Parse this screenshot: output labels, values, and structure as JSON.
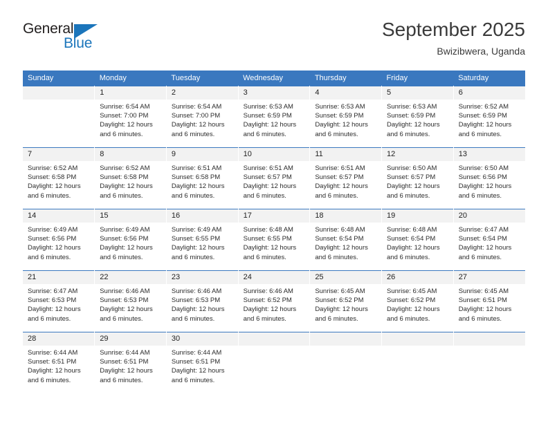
{
  "brand": {
    "name_dark": "General",
    "name_blue": "Blue",
    "accent_color": "#1b75bb"
  },
  "header": {
    "title": "September 2025",
    "subtitle": "Bwizibwera, Uganda"
  },
  "theme": {
    "header_row_color": "#3a78bf",
    "daynum_band_color": "#f2f2f2",
    "text_color": "#2b2b2b"
  },
  "weekday_headers": [
    "Sunday",
    "Monday",
    "Tuesday",
    "Wednesday",
    "Thursday",
    "Friday",
    "Saturday"
  ],
  "weeks": [
    [
      {
        "day": "",
        "empty": true,
        "sunrise": "",
        "sunset": "",
        "daylight_line1": "",
        "daylight_line2": ""
      },
      {
        "day": "1",
        "empty": false,
        "sunrise": "Sunrise: 6:54 AM",
        "sunset": "Sunset: 7:00 PM",
        "daylight_line1": "Daylight: 12 hours",
        "daylight_line2": "and 6 minutes."
      },
      {
        "day": "2",
        "empty": false,
        "sunrise": "Sunrise: 6:54 AM",
        "sunset": "Sunset: 7:00 PM",
        "daylight_line1": "Daylight: 12 hours",
        "daylight_line2": "and 6 minutes."
      },
      {
        "day": "3",
        "empty": false,
        "sunrise": "Sunrise: 6:53 AM",
        "sunset": "Sunset: 6:59 PM",
        "daylight_line1": "Daylight: 12 hours",
        "daylight_line2": "and 6 minutes."
      },
      {
        "day": "4",
        "empty": false,
        "sunrise": "Sunrise: 6:53 AM",
        "sunset": "Sunset: 6:59 PM",
        "daylight_line1": "Daylight: 12 hours",
        "daylight_line2": "and 6 minutes."
      },
      {
        "day": "5",
        "empty": false,
        "sunrise": "Sunrise: 6:53 AM",
        "sunset": "Sunset: 6:59 PM",
        "daylight_line1": "Daylight: 12 hours",
        "daylight_line2": "and 6 minutes."
      },
      {
        "day": "6",
        "empty": false,
        "sunrise": "Sunrise: 6:52 AM",
        "sunset": "Sunset: 6:59 PM",
        "daylight_line1": "Daylight: 12 hours",
        "daylight_line2": "and 6 minutes."
      }
    ],
    [
      {
        "day": "7",
        "empty": false,
        "sunrise": "Sunrise: 6:52 AM",
        "sunset": "Sunset: 6:58 PM",
        "daylight_line1": "Daylight: 12 hours",
        "daylight_line2": "and 6 minutes."
      },
      {
        "day": "8",
        "empty": false,
        "sunrise": "Sunrise: 6:52 AM",
        "sunset": "Sunset: 6:58 PM",
        "daylight_line1": "Daylight: 12 hours",
        "daylight_line2": "and 6 minutes."
      },
      {
        "day": "9",
        "empty": false,
        "sunrise": "Sunrise: 6:51 AM",
        "sunset": "Sunset: 6:58 PM",
        "daylight_line1": "Daylight: 12 hours",
        "daylight_line2": "and 6 minutes."
      },
      {
        "day": "10",
        "empty": false,
        "sunrise": "Sunrise: 6:51 AM",
        "sunset": "Sunset: 6:57 PM",
        "daylight_line1": "Daylight: 12 hours",
        "daylight_line2": "and 6 minutes."
      },
      {
        "day": "11",
        "empty": false,
        "sunrise": "Sunrise: 6:51 AM",
        "sunset": "Sunset: 6:57 PM",
        "daylight_line1": "Daylight: 12 hours",
        "daylight_line2": "and 6 minutes."
      },
      {
        "day": "12",
        "empty": false,
        "sunrise": "Sunrise: 6:50 AM",
        "sunset": "Sunset: 6:57 PM",
        "daylight_line1": "Daylight: 12 hours",
        "daylight_line2": "and 6 minutes."
      },
      {
        "day": "13",
        "empty": false,
        "sunrise": "Sunrise: 6:50 AM",
        "sunset": "Sunset: 6:56 PM",
        "daylight_line1": "Daylight: 12 hours",
        "daylight_line2": "and 6 minutes."
      }
    ],
    [
      {
        "day": "14",
        "empty": false,
        "sunrise": "Sunrise: 6:49 AM",
        "sunset": "Sunset: 6:56 PM",
        "daylight_line1": "Daylight: 12 hours",
        "daylight_line2": "and 6 minutes."
      },
      {
        "day": "15",
        "empty": false,
        "sunrise": "Sunrise: 6:49 AM",
        "sunset": "Sunset: 6:56 PM",
        "daylight_line1": "Daylight: 12 hours",
        "daylight_line2": "and 6 minutes."
      },
      {
        "day": "16",
        "empty": false,
        "sunrise": "Sunrise: 6:49 AM",
        "sunset": "Sunset: 6:55 PM",
        "daylight_line1": "Daylight: 12 hours",
        "daylight_line2": "and 6 minutes."
      },
      {
        "day": "17",
        "empty": false,
        "sunrise": "Sunrise: 6:48 AM",
        "sunset": "Sunset: 6:55 PM",
        "daylight_line1": "Daylight: 12 hours",
        "daylight_line2": "and 6 minutes."
      },
      {
        "day": "18",
        "empty": false,
        "sunrise": "Sunrise: 6:48 AM",
        "sunset": "Sunset: 6:54 PM",
        "daylight_line1": "Daylight: 12 hours",
        "daylight_line2": "and 6 minutes."
      },
      {
        "day": "19",
        "empty": false,
        "sunrise": "Sunrise: 6:48 AM",
        "sunset": "Sunset: 6:54 PM",
        "daylight_line1": "Daylight: 12 hours",
        "daylight_line2": "and 6 minutes."
      },
      {
        "day": "20",
        "empty": false,
        "sunrise": "Sunrise: 6:47 AM",
        "sunset": "Sunset: 6:54 PM",
        "daylight_line1": "Daylight: 12 hours",
        "daylight_line2": "and 6 minutes."
      }
    ],
    [
      {
        "day": "21",
        "empty": false,
        "sunrise": "Sunrise: 6:47 AM",
        "sunset": "Sunset: 6:53 PM",
        "daylight_line1": "Daylight: 12 hours",
        "daylight_line2": "and 6 minutes."
      },
      {
        "day": "22",
        "empty": false,
        "sunrise": "Sunrise: 6:46 AM",
        "sunset": "Sunset: 6:53 PM",
        "daylight_line1": "Daylight: 12 hours",
        "daylight_line2": "and 6 minutes."
      },
      {
        "day": "23",
        "empty": false,
        "sunrise": "Sunrise: 6:46 AM",
        "sunset": "Sunset: 6:53 PM",
        "daylight_line1": "Daylight: 12 hours",
        "daylight_line2": "and 6 minutes."
      },
      {
        "day": "24",
        "empty": false,
        "sunrise": "Sunrise: 6:46 AM",
        "sunset": "Sunset: 6:52 PM",
        "daylight_line1": "Daylight: 12 hours",
        "daylight_line2": "and 6 minutes."
      },
      {
        "day": "25",
        "empty": false,
        "sunrise": "Sunrise: 6:45 AM",
        "sunset": "Sunset: 6:52 PM",
        "daylight_line1": "Daylight: 12 hours",
        "daylight_line2": "and 6 minutes."
      },
      {
        "day": "26",
        "empty": false,
        "sunrise": "Sunrise: 6:45 AM",
        "sunset": "Sunset: 6:52 PM",
        "daylight_line1": "Daylight: 12 hours",
        "daylight_line2": "and 6 minutes."
      },
      {
        "day": "27",
        "empty": false,
        "sunrise": "Sunrise: 6:45 AM",
        "sunset": "Sunset: 6:51 PM",
        "daylight_line1": "Daylight: 12 hours",
        "daylight_line2": "and 6 minutes."
      }
    ],
    [
      {
        "day": "28",
        "empty": false,
        "sunrise": "Sunrise: 6:44 AM",
        "sunset": "Sunset: 6:51 PM",
        "daylight_line1": "Daylight: 12 hours",
        "daylight_line2": "and 6 minutes."
      },
      {
        "day": "29",
        "empty": false,
        "sunrise": "Sunrise: 6:44 AM",
        "sunset": "Sunset: 6:51 PM",
        "daylight_line1": "Daylight: 12 hours",
        "daylight_line2": "and 6 minutes."
      },
      {
        "day": "30",
        "empty": false,
        "sunrise": "Sunrise: 6:44 AM",
        "sunset": "Sunset: 6:51 PM",
        "daylight_line1": "Daylight: 12 hours",
        "daylight_line2": "and 6 minutes."
      },
      {
        "day": "",
        "empty": true,
        "sunrise": "",
        "sunset": "",
        "daylight_line1": "",
        "daylight_line2": ""
      },
      {
        "day": "",
        "empty": true,
        "sunrise": "",
        "sunset": "",
        "daylight_line1": "",
        "daylight_line2": ""
      },
      {
        "day": "",
        "empty": true,
        "sunrise": "",
        "sunset": "",
        "daylight_line1": "",
        "daylight_line2": ""
      },
      {
        "day": "",
        "empty": true,
        "sunrise": "",
        "sunset": "",
        "daylight_line1": "",
        "daylight_line2": ""
      }
    ]
  ]
}
